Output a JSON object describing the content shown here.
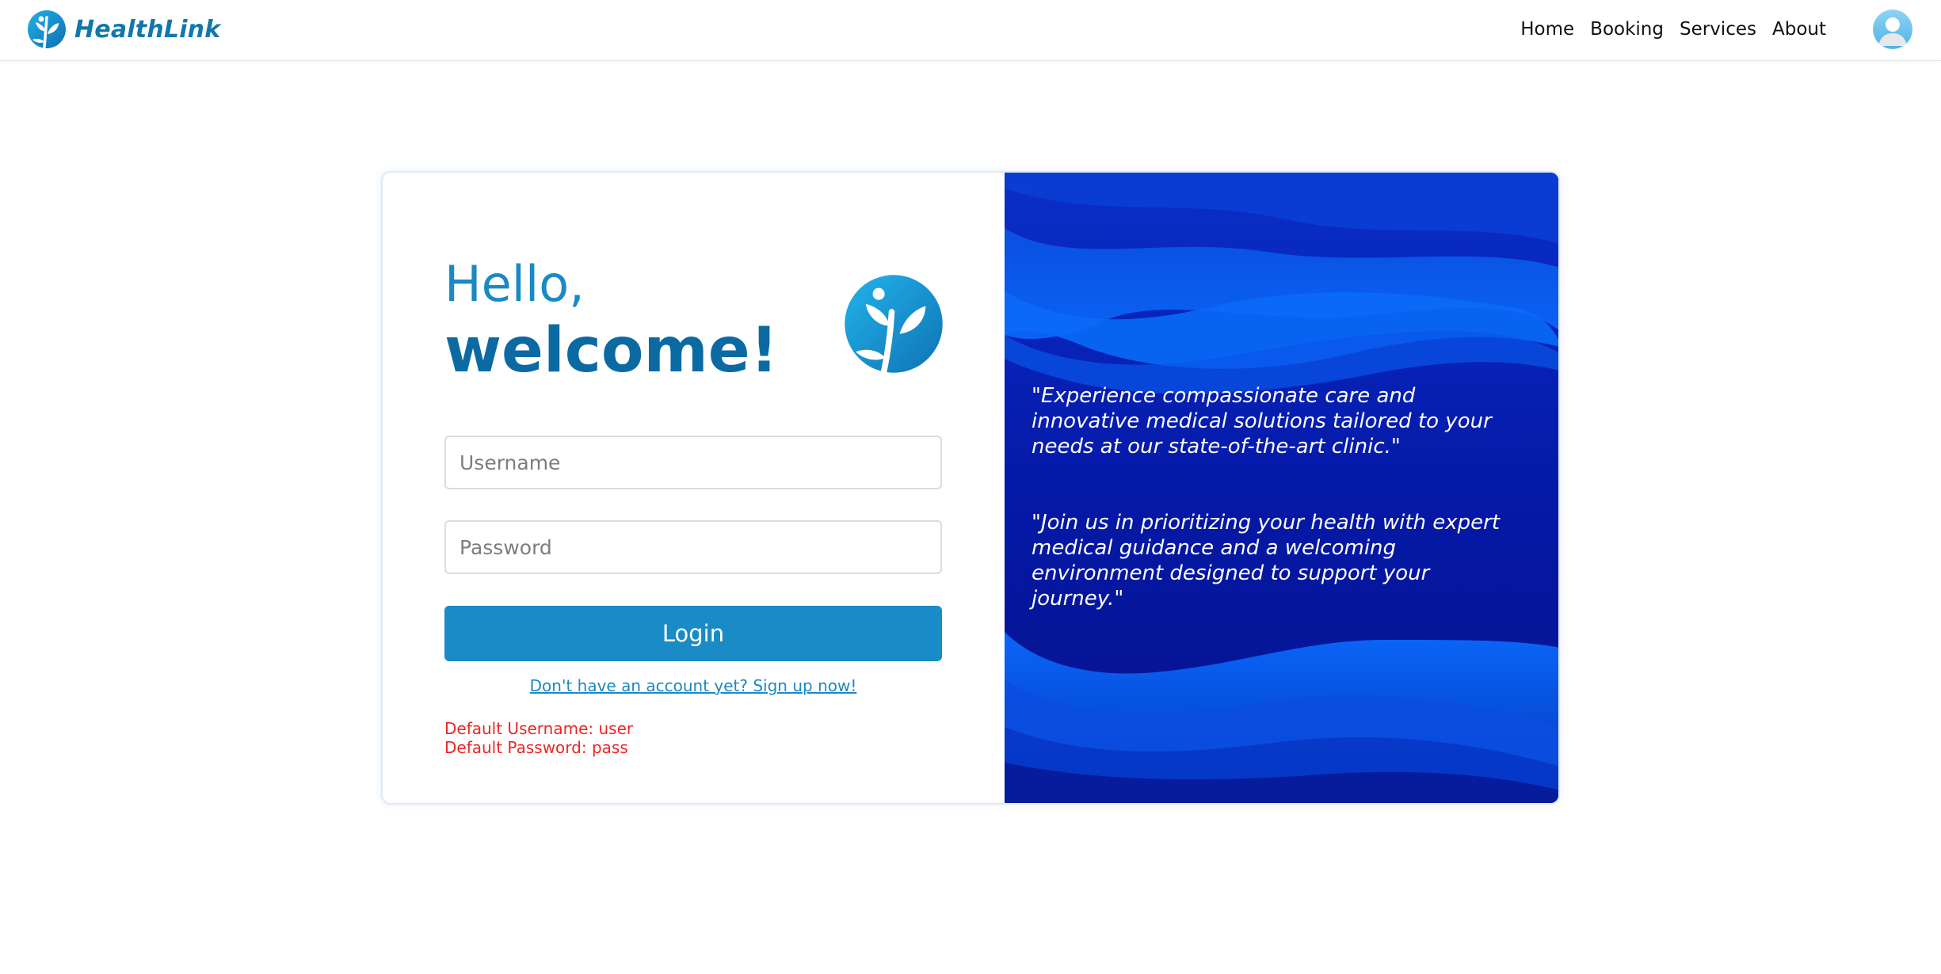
{
  "brand": {
    "name": "HealthLink",
    "logo_icon": "leaf-person-icon",
    "color": "#1278ab"
  },
  "nav": {
    "items": [
      {
        "label": "Home"
      },
      {
        "label": "Booking"
      },
      {
        "label": "Services"
      },
      {
        "label": "About"
      }
    ],
    "avatar_icon": "user-avatar-icon"
  },
  "login": {
    "greeting_line1": "Hello,",
    "greeting_line2": "welcome!",
    "username_placeholder": "Username",
    "password_placeholder": "Password",
    "username_value": "",
    "password_value": "",
    "button_label": "Login",
    "signup_link": "Don't have an account yet? Sign up now!",
    "default_username": "Default Username: user",
    "default_password": "Default Password: pass"
  },
  "quotes": [
    "\"Experience compassionate care and innovative medical solutions tailored to your needs at our state-of-the-art clinic.\"",
    "\"Join us in prioritizing your health with expert medical guidance and a welcoming environment designed to support your journey.\""
  ],
  "colors": {
    "primary": "#1a8bc6",
    "dark_blue": "#0517a3",
    "bright_blue": "#0a5df0",
    "error_red": "#ec2626"
  }
}
